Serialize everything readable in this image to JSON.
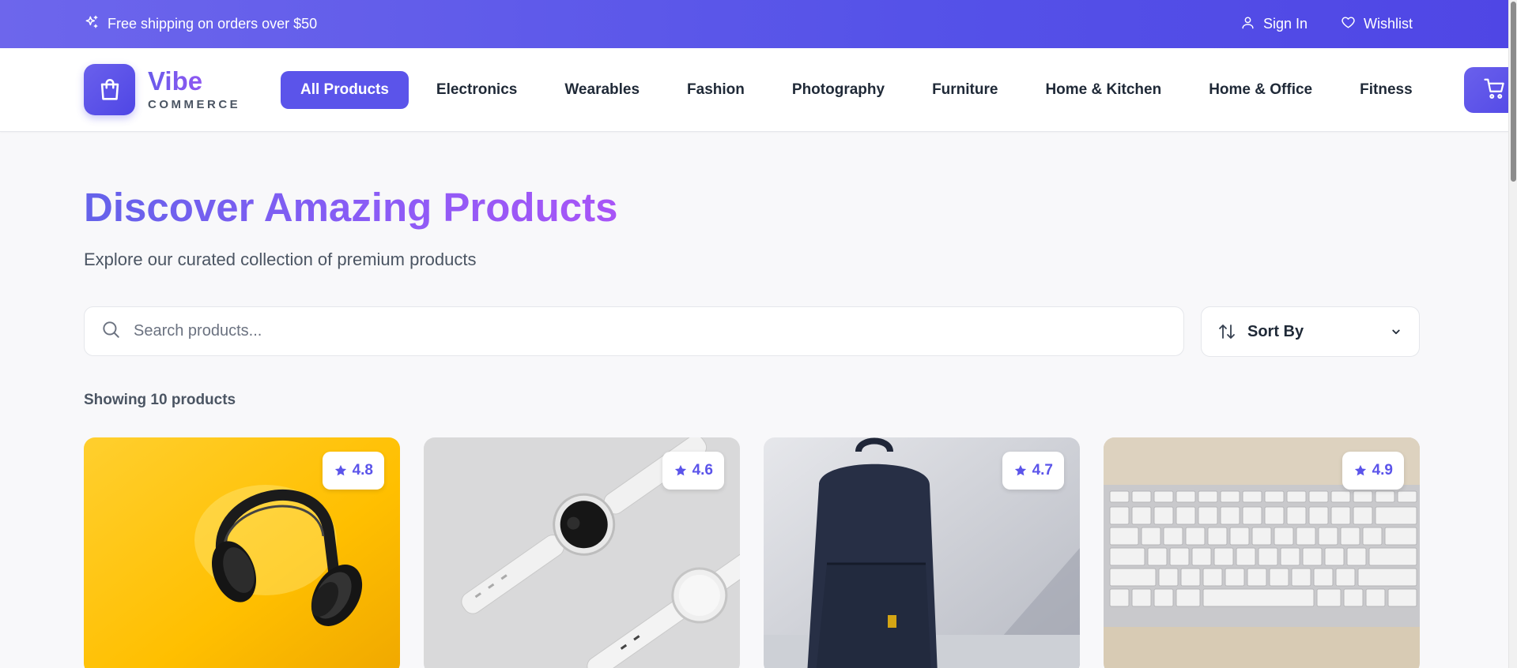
{
  "topbar": {
    "promo_text": "Free shipping on orders over $50",
    "promo_icon": "sparkles-icon",
    "sign_in": "Sign In",
    "wishlist": "Wishlist"
  },
  "brand": {
    "name": "Vibe",
    "tagline": "COMMERCE"
  },
  "nav": {
    "items": [
      "All Products",
      "Electronics",
      "Wearables",
      "Fashion",
      "Photography",
      "Furniture",
      "Home & Kitchen",
      "Home & Office",
      "Fitness"
    ],
    "active": "All Products"
  },
  "hero": {
    "title": "Discover Amazing Products",
    "subtitle": "Explore our curated collection of premium products"
  },
  "search": {
    "placeholder": "Search products..."
  },
  "sort": {
    "label": "Sort By"
  },
  "results": {
    "count_text": "Showing 10 products"
  },
  "products": [
    {
      "rating": "4.8",
      "image": "headphones"
    },
    {
      "rating": "4.6",
      "image": "smartwatches"
    },
    {
      "rating": "4.7",
      "image": "backpack"
    },
    {
      "rating": "4.9",
      "image": "keyboard"
    }
  ],
  "colors": {
    "accent": "#5b54ea",
    "topbar": "#5552e8",
    "gradient_end": "#a855f7"
  }
}
